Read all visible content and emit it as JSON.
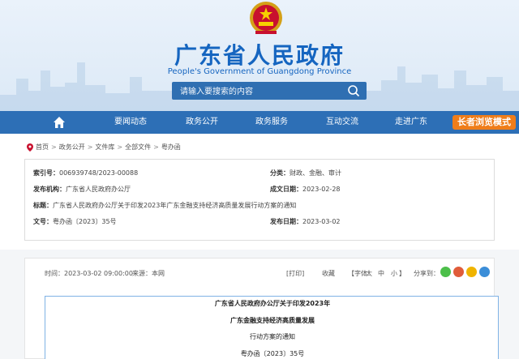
{
  "header": {
    "site_title": "广东省人民政府",
    "site_subtitle": "People's Government of Guangdong Province",
    "search_placeholder": "请输入要搜索的内容"
  },
  "nav": {
    "items": [
      "要闻动态",
      "政务公开",
      "政务服务",
      "互动交流",
      "走进广东"
    ],
    "elder_mode": "长者浏览模式"
  },
  "breadcrumb": [
    "首页",
    "政务公开",
    "文件库",
    "全部文件",
    "粤办函"
  ],
  "meta": {
    "index_label": "索引号：",
    "index_value": "006939748/2023-00088",
    "category_label": "分类：",
    "category_value": "财政、金融、审计",
    "issuer_label": "发布机构：",
    "issuer_value": "广东省人民政府办公厅",
    "created_label": "成文日期：",
    "created_value": "2023-02-28",
    "title_label": "标题：",
    "title_value": "广东省人民政府办公厅关于印发2023年广东金融支持经济高质量发展行动方案的通知",
    "docno_label": "文号：",
    "docno_value": "粤办函〔2023〕35号",
    "published_label": "发布日期：",
    "published_value": "2023-03-02"
  },
  "toolbar": {
    "time": "时间：2023-03-02 09:00:00",
    "source": "来源：本网",
    "print": "[打印]",
    "favorite": "收藏",
    "font_label": "【字体：",
    "font_large": "大",
    "font_medium": "中",
    "font_small": "小",
    "font_end": "】",
    "share": "分享到："
  },
  "share_colors": {
    "wechat": "#4cbf4a",
    "weibo": "#e05c3a",
    "qzone": "#f0b400",
    "qq": "#3b8ed8"
  },
  "document": {
    "line1": "广东省人民政府办公厅关于印发2023年",
    "line2": "广东金融支持经济高质量发展",
    "line3": "行动方案的通知",
    "line4": "粤办函〔2023〕35号"
  }
}
